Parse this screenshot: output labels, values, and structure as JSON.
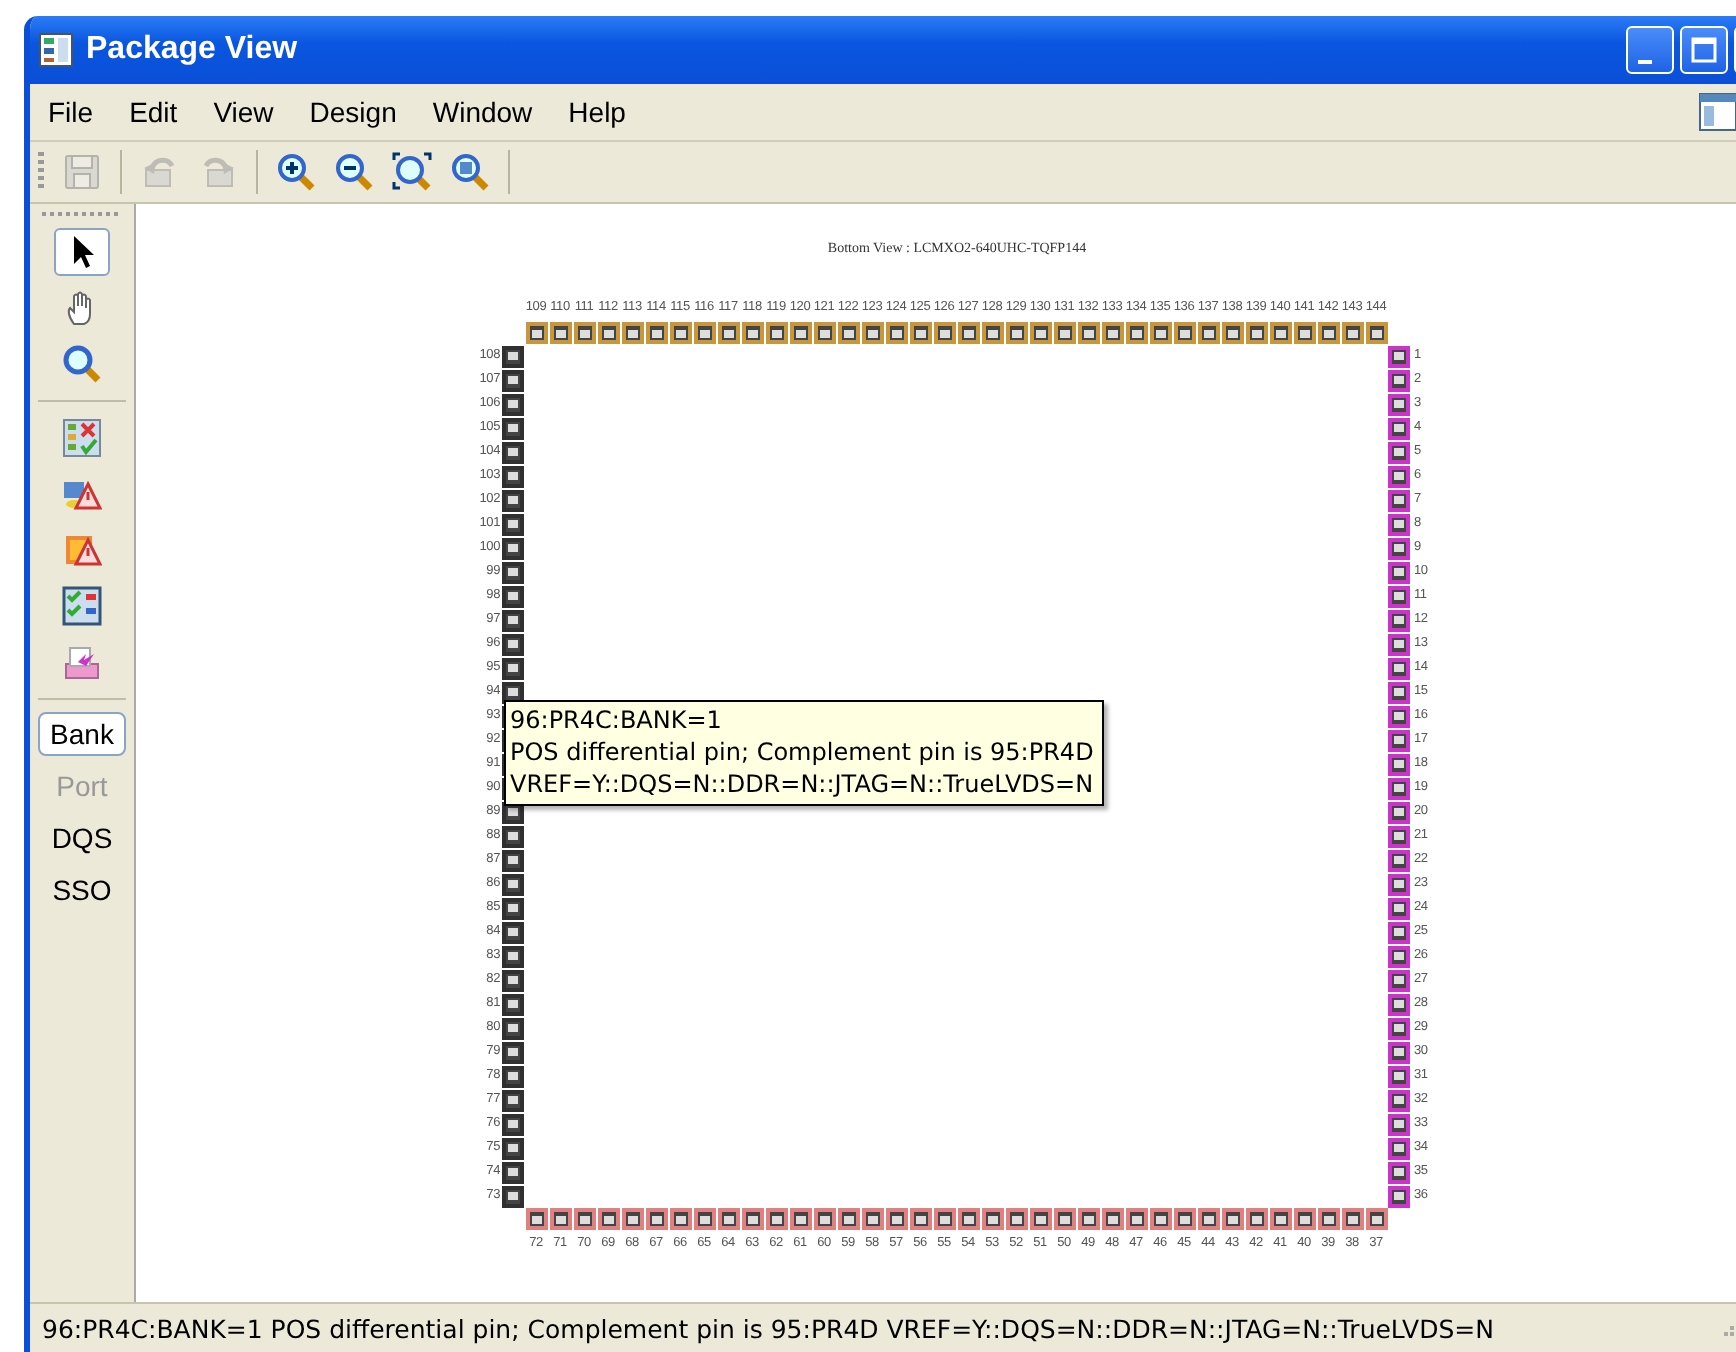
{
  "window": {
    "title": "Package View"
  },
  "menu": [
    "File",
    "Edit",
    "View",
    "Design",
    "Window",
    "Help"
  ],
  "toolbar": [
    {
      "kind": "save",
      "disabled": true
    },
    {
      "kind": "undo",
      "disabled": true
    },
    {
      "kind": "redo",
      "disabled": true
    },
    {
      "kind": "zoom-in",
      "disabled": false
    },
    {
      "kind": "zoom-out",
      "disabled": false
    },
    {
      "kind": "zoom-fit",
      "disabled": false
    },
    {
      "kind": "zoom-area",
      "disabled": false
    }
  ],
  "tools": [
    {
      "kind": "pointer",
      "selected": true
    },
    {
      "kind": "hand",
      "selected": false
    },
    {
      "kind": "zoom",
      "selected": false
    }
  ],
  "actions": [
    {
      "kind": "check-list"
    },
    {
      "kind": "warning-folder"
    },
    {
      "kind": "warning-chip"
    },
    {
      "kind": "check-grid"
    },
    {
      "kind": "export"
    }
  ],
  "view_modes": [
    {
      "label": "Bank",
      "selected": true,
      "disabled": false
    },
    {
      "label": "Port",
      "selected": false,
      "disabled": true
    },
    {
      "label": "DQS",
      "selected": false,
      "disabled": false
    },
    {
      "label": "SSO",
      "selected": false,
      "disabled": false
    }
  ],
  "canvas": {
    "title": "Bottom View : LCMXO2-640UHC-TQFP144",
    "sides": [
      {
        "kind": "top",
        "color": "#c8963c",
        "pins": [
          "109",
          "110",
          "111",
          "112",
          "113",
          "114",
          "115",
          "116",
          "117",
          "118",
          "119",
          "120",
          "121",
          "122",
          "123",
          "124",
          "125",
          "126",
          "127",
          "128",
          "129",
          "130",
          "131",
          "132",
          "133",
          "134",
          "135",
          "136",
          "137",
          "138",
          "139",
          "140",
          "141",
          "142",
          "143",
          "144"
        ]
      },
      {
        "kind": "right",
        "color": "#cc33cc",
        "pins": [
          "1",
          "2",
          "3",
          "4",
          "5",
          "6",
          "7",
          "8",
          "9",
          "10",
          "11",
          "12",
          "13",
          "14",
          "15",
          "16",
          "17",
          "18",
          "19",
          "20",
          "21",
          "22",
          "23",
          "24",
          "25",
          "26",
          "27",
          "28",
          "29",
          "30",
          "31",
          "32",
          "33",
          "34",
          "35",
          "36"
        ]
      },
      {
        "kind": "bottom",
        "color": "#e08080",
        "pins": [
          "72",
          "71",
          "70",
          "69",
          "68",
          "67",
          "66",
          "65",
          "64",
          "63",
          "62",
          "61",
          "60",
          "59",
          "58",
          "57",
          "56",
          "55",
          "54",
          "53",
          "52",
          "51",
          "50",
          "49",
          "48",
          "47",
          "46",
          "45",
          "44",
          "43",
          "42",
          "41",
          "40",
          "39",
          "38",
          "37"
        ]
      },
      {
        "kind": "left",
        "color": "#303030",
        "pins": [
          "108",
          "107",
          "106",
          "105",
          "104",
          "103",
          "102",
          "101",
          "100",
          "99",
          "98",
          "97",
          "96",
          "95",
          "94",
          "93",
          "92",
          "91",
          "90",
          "89",
          "88",
          "87",
          "86",
          "85",
          "84",
          "83",
          "82",
          "81",
          "80",
          "79",
          "78",
          "77",
          "76",
          "75",
          "74",
          "73"
        ]
      }
    ],
    "tooltip": [
      "96:PR4C:BANK=1",
      "POS differential pin; Complement pin is 95:PR4D",
      "VREF=Y::DQS=N::DDR=N::JTAG=N::TrueLVDS=N"
    ]
  },
  "status_bar": "96:PR4C:BANK=1 POS differential pin; Complement pin is 95:PR4D VREF=Y::DQS=N::DDR=N::JTAG=N::TrueLVDS=N"
}
